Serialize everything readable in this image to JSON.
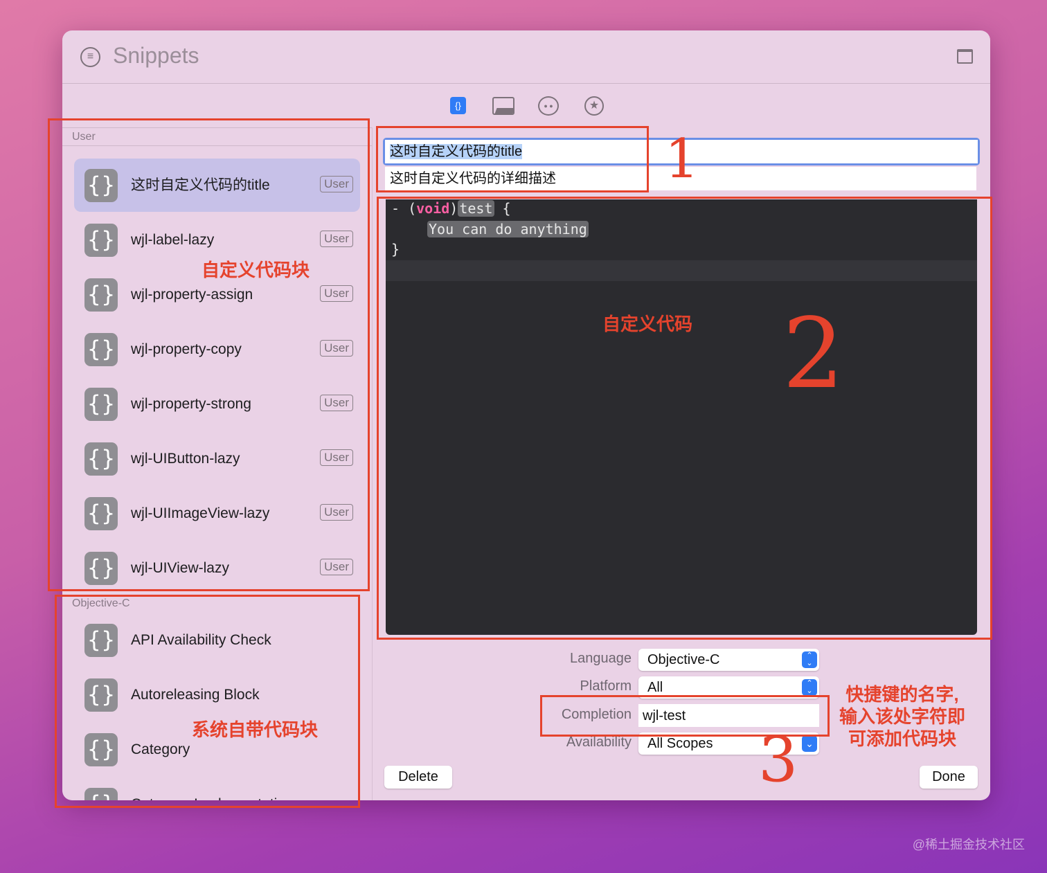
{
  "window": {
    "title": "Snippets"
  },
  "toolbar": {
    "tabs": [
      {
        "name": "code-snippets",
        "glyph": "{}"
      },
      {
        "name": "media",
        "glyph": "🖼"
      },
      {
        "name": "colors",
        "glyph": "🎨"
      },
      {
        "name": "favorites",
        "glyph": "★"
      }
    ]
  },
  "sidebar": {
    "sections": [
      {
        "title": "User",
        "items": [
          {
            "label": "这时自定义代码的title",
            "badge": "User",
            "selected": true
          },
          {
            "label": "wjl-label-lazy",
            "badge": "User"
          },
          {
            "label": "wjl-property-assign",
            "badge": "User"
          },
          {
            "label": "wjl-property-copy",
            "badge": "User"
          },
          {
            "label": "wjl-property-strong",
            "badge": "User"
          },
          {
            "label": "wjl-UIButton-lazy",
            "badge": "User"
          },
          {
            "label": "wjl-UIImageView-lazy",
            "badge": "User"
          },
          {
            "label": "wjl-UIView-lazy",
            "badge": "User"
          }
        ]
      },
      {
        "title": "Objective-C",
        "items": [
          {
            "label": "API Availability Check"
          },
          {
            "label": "Autoreleasing Block"
          },
          {
            "label": "Category"
          },
          {
            "label": "Category Implementation"
          }
        ]
      }
    ],
    "icon_glyph": "{}"
  },
  "detail": {
    "title": "这时自定义代码的title",
    "summary": "这时自定义代码的详细描述",
    "code": {
      "dash": "- (",
      "void": "void",
      ")": ")",
      "test": "test",
      "brace_open": " {",
      "body": "You can do anything",
      "brace_close": "}"
    },
    "language_label": "Language",
    "language": "Objective-C",
    "platform_label": "Platform",
    "platform": "All",
    "completion_label": "Completion",
    "completion": "wjl-test",
    "availability_label": "Availability",
    "availability": "All Scopes",
    "delete": "Delete",
    "done": "Done"
  },
  "annotations": {
    "custom_snippets": "自定义代码块",
    "system_snippets": "系统自带代码块",
    "custom_code": "自定义代码",
    "completion_note": [
      "快捷键的名字,",
      "输入该处字符即",
      "可添加代码块"
    ],
    "num1": "1",
    "num2": "2",
    "num3": "3"
  },
  "colors": {
    "accent": "#2f7cf6",
    "annotation": "#e5432d",
    "editor_bg": "#2b2b2f",
    "keyword": "#fc5fa3"
  },
  "watermark": "@稀土掘金技术社区"
}
